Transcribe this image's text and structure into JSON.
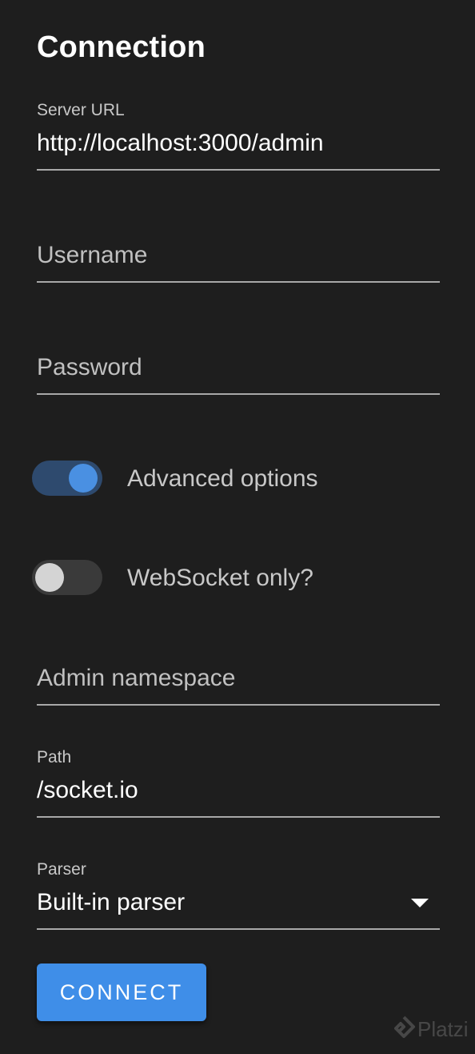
{
  "page": {
    "title": "Connection"
  },
  "form": {
    "server_url": {
      "label": "Server URL",
      "value": "http://localhost:3000/admin"
    },
    "username": {
      "placeholder": "Username",
      "value": ""
    },
    "password": {
      "placeholder": "Password",
      "value": ""
    },
    "advanced_options": {
      "label": "Advanced options",
      "checked": true
    },
    "websocket_only": {
      "label": "WebSocket only?",
      "checked": false
    },
    "admin_namespace": {
      "placeholder": "Admin namespace",
      "value": ""
    },
    "path": {
      "label": "Path",
      "value": "/socket.io"
    },
    "parser": {
      "label": "Parser",
      "value": "Built-in parser"
    },
    "connect_label": "CONNECT"
  },
  "watermark": {
    "text": "Platzi"
  },
  "colors": {
    "background": "#1e1e1e",
    "accent": "#3f8ee8",
    "toggle_on_track": "#2e4a6e",
    "toggle_on_knob": "#4a90e2",
    "toggle_off_track": "#3a3a3a",
    "toggle_off_knob": "#d4d4d4"
  }
}
